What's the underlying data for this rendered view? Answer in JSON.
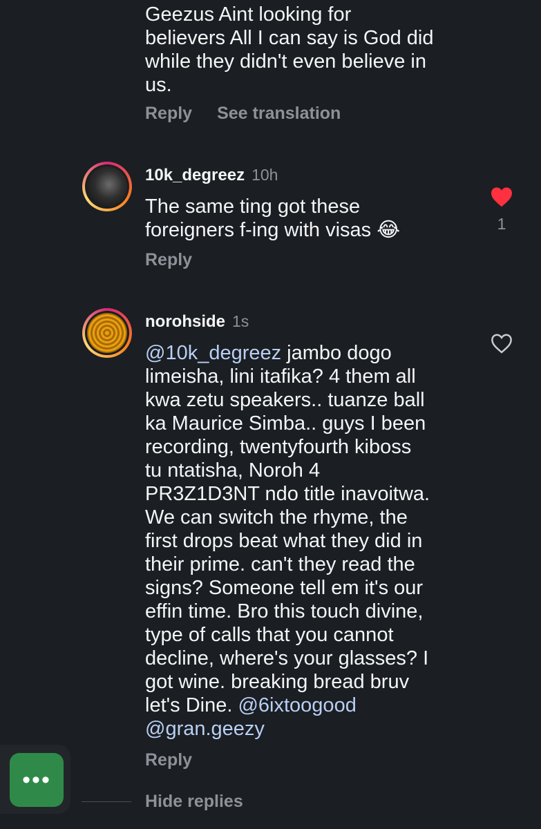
{
  "comment_top": {
    "text": "Geezus Aint looking for\nbelievers All I can say is God did\nwhile they didn't even believe in\nus.",
    "reply_label": "Reply",
    "translate_label": "See translation"
  },
  "comment_1": {
    "username": "10k_degreez",
    "time": "10h",
    "text": "The same ting got these\nforeigners f-ing with visas 😂",
    "reply_label": "Reply",
    "like_count": "1",
    "liked": true
  },
  "comment_2": {
    "username": "norohside",
    "time": "1s",
    "mention_1": "@10k_degreez",
    "text_main": " jambo dogo\nlimeisha, lini itafika? 4 them all\nkwa zetu speakers.. tuanze ball\nka Maurice Simba.. guys I been\nrecording, twentyfourth kiboss\ntu ntatisha, Noroh 4\nPR3Z1D3NT ndo title inavoitwa.\nWe can switch the rhyme, the\nfirst drops beat what they did in\ntheir prime. can't they read the\nsigns? Someone tell em it's our\neffin time. Bro this touch divine,\ntype of calls that you cannot\ndecline, where's your glasses? I\ngot wine. breaking bread bruv\nlet's Dine. ",
    "mention_2": "@6ixtoogood",
    "mention_3": "@gran.geezy",
    "reply_label": "Reply",
    "liked": false
  },
  "hide_replies_label": "Hide replies",
  "fab_label": "•••",
  "colors": {
    "like_red": "#ff3040",
    "fab_green": "#2f8a4a",
    "mention_blue": "#b8cff5"
  }
}
